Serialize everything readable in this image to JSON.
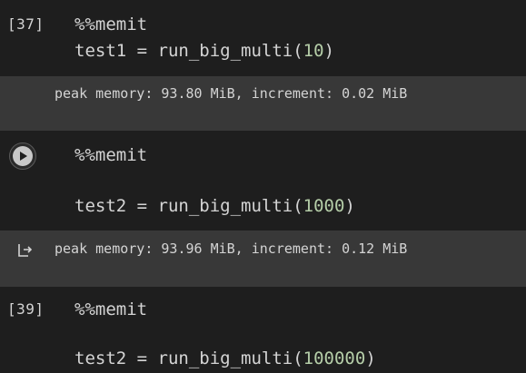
{
  "cells": [
    {
      "exec_count": "[37]",
      "magic": "%%memit",
      "code_prefix": "test1 = run_big_multi(",
      "code_arg": "10",
      "code_suffix": ")",
      "output": "peak memory: 93.80 MiB, increment: 0.02 MiB"
    },
    {
      "exec_count": "",
      "magic": "%%memit",
      "code_prefix": "test2 = run_big_multi(",
      "code_arg": "1000",
      "code_suffix": ")",
      "output": "peak memory: 93.96 MiB, increment: 0.12 MiB"
    },
    {
      "exec_count": "[39]",
      "magic": "%%memit",
      "code_prefix": "test2 = run_big_multi(",
      "code_arg": "100000",
      "code_suffix": ")"
    }
  ],
  "icons": {
    "run": "play-icon",
    "output": "output-arrow-icon"
  },
  "colors": {
    "cell_bg": "#1e1e1e",
    "output_bg": "#383838",
    "number": "#b5cea8",
    "text": "#d4d4d4"
  }
}
